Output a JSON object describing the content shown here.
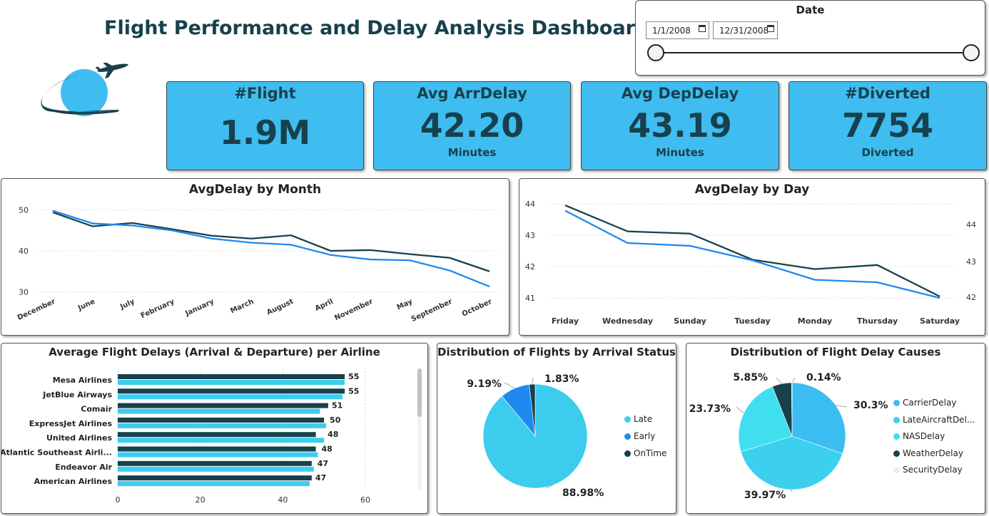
{
  "header": {
    "title": "Flight Performance and Delay Analysis Dashboard"
  },
  "date_filter": {
    "label": "Date",
    "start": "1/1/2008",
    "end": "12/31/2008"
  },
  "kpis": [
    {
      "label": "#Flight",
      "value": "1.9M",
      "unit": ""
    },
    {
      "label": "Avg ArrDelay",
      "value": "42.20",
      "unit": "Minutes"
    },
    {
      "label": "Avg DepDelay",
      "value": "43.19",
      "unit": "Minutes"
    },
    {
      "label": "#Diverted",
      "value": "7754",
      "unit": "Diverted"
    }
  ],
  "colors": {
    "dark": "#17414c",
    "blue": "#2188ee",
    "cyan": "#3ccdee",
    "kpi_bg": "#3fbdf0",
    "light_gray": "#eeeeee"
  },
  "chart_data": [
    {
      "type": "line",
      "title": "AvgDelay by Month",
      "categories": [
        "December",
        "June",
        "July",
        "February",
        "January",
        "March",
        "August",
        "April",
        "November",
        "May",
        "September",
        "October"
      ],
      "ylim": [
        28,
        52
      ],
      "yticks": [
        "50",
        "40",
        "30"
      ],
      "series": [
        {
          "values": [
            49.4,
            46.0,
            46.8,
            45.3,
            43.7,
            43.0,
            43.8,
            40.0,
            40.2,
            39.2,
            38.3,
            35.0
          ],
          "color": "#17414c"
        },
        {
          "values": [
            49.8,
            46.7,
            46.2,
            45.0,
            43.0,
            42.0,
            41.5,
            39.0,
            37.9,
            37.7,
            35.2,
            31.3
          ],
          "color": "#2188ee"
        }
      ]
    },
    {
      "type": "line",
      "title": "AvgDelay by Day",
      "categories": [
        "Friday",
        "Wednesday",
        "Sunday",
        "Tuesday",
        "Monday",
        "Thursday",
        "Saturday"
      ],
      "ylim": [
        40.8,
        44.2
      ],
      "yticks_left": [
        "44",
        "43",
        "42",
        "41"
      ],
      "yticks_right": [
        "44",
        "43",
        "42"
      ],
      "series": [
        {
          "values": [
            43.95,
            43.12,
            43.05,
            42.22,
            41.92,
            42.05,
            41.05
          ],
          "color": "#17414c"
        },
        {
          "values": [
            43.78,
            42.75,
            42.66,
            42.2,
            41.58,
            41.5,
            41.0
          ],
          "color": "#2188ee"
        }
      ]
    },
    {
      "type": "bar",
      "title": "Average Flight Delays (Arrival & Departure) per Airline",
      "categories": [
        "Mesa Airlines",
        "JetBlue Airways",
        "Comair",
        "ExpressJet Airlines",
        "United Airlines",
        "Atlantic Southeast Airli...",
        "Endeavor Air",
        "American Airlines"
      ],
      "xlim": [
        0,
        60
      ],
      "xticks": [
        "0",
        "20",
        "40",
        "60"
      ],
      "series": [
        {
          "values": [
            55,
            55,
            51,
            50,
            48,
            48,
            47,
            47
          ],
          "labels": [
            "55",
            "55",
            "51",
            "50",
            "48",
            "48",
            "47",
            "47"
          ],
          "color": "#17414c"
        },
        {
          "values": [
            55,
            54.5,
            49,
            50.5,
            50,
            48.5,
            47.5,
            46.5
          ],
          "color": "#3ccdee"
        }
      ]
    },
    {
      "type": "pie",
      "title": "Distribution of Flights by Arrival Status",
      "slices": [
        {
          "name": "Late",
          "value": 88.98,
          "label": "88.98%",
          "color": "#3ccdee"
        },
        {
          "name": "Early",
          "value": 9.19,
          "label": "9.19%",
          "color": "#1e8af0"
        },
        {
          "name": "OnTime",
          "value": 1.83,
          "label": "1.83%",
          "color": "#17414c"
        }
      ]
    },
    {
      "type": "pie",
      "title": "Distribution of Flight Delay Causes",
      "slices": [
        {
          "name": "CarrierDelay",
          "value": 30.3,
          "label": "30.3%",
          "color": "#3cbdf2"
        },
        {
          "name": "LateAircraftDel...",
          "value": 39.97,
          "label": "39.97%",
          "color": "#3dcfee"
        },
        {
          "name": "NASDelay",
          "value": 23.73,
          "label": "23.73%",
          "color": "#3fdff0"
        },
        {
          "name": "WeatherDelay",
          "value": 5.85,
          "label": "5.85%",
          "color": "#17414c"
        },
        {
          "name": "SecurityDelay",
          "value": 0.14,
          "label": "0.14%",
          "color": "#eeeeee"
        }
      ]
    }
  ]
}
